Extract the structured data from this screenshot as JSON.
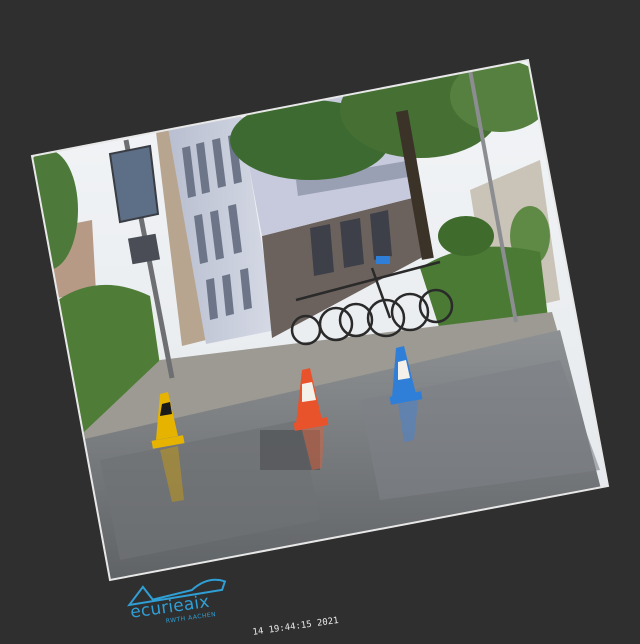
{
  "scene": {
    "description_icon": "photo-street-scene",
    "colors": {
      "background": "#2f2f2f",
      "cone_orange": "#e8532b",
      "cone_blue": "#2f7fd8",
      "cone_yellow": "#e6b400",
      "logo_blue": "#2f9fd6"
    }
  },
  "watermark": {
    "brand": "ecurieaix",
    "sub": "RWTH AACHEN"
  },
  "timestamp": {
    "text": "14 19:44:15 2021"
  }
}
